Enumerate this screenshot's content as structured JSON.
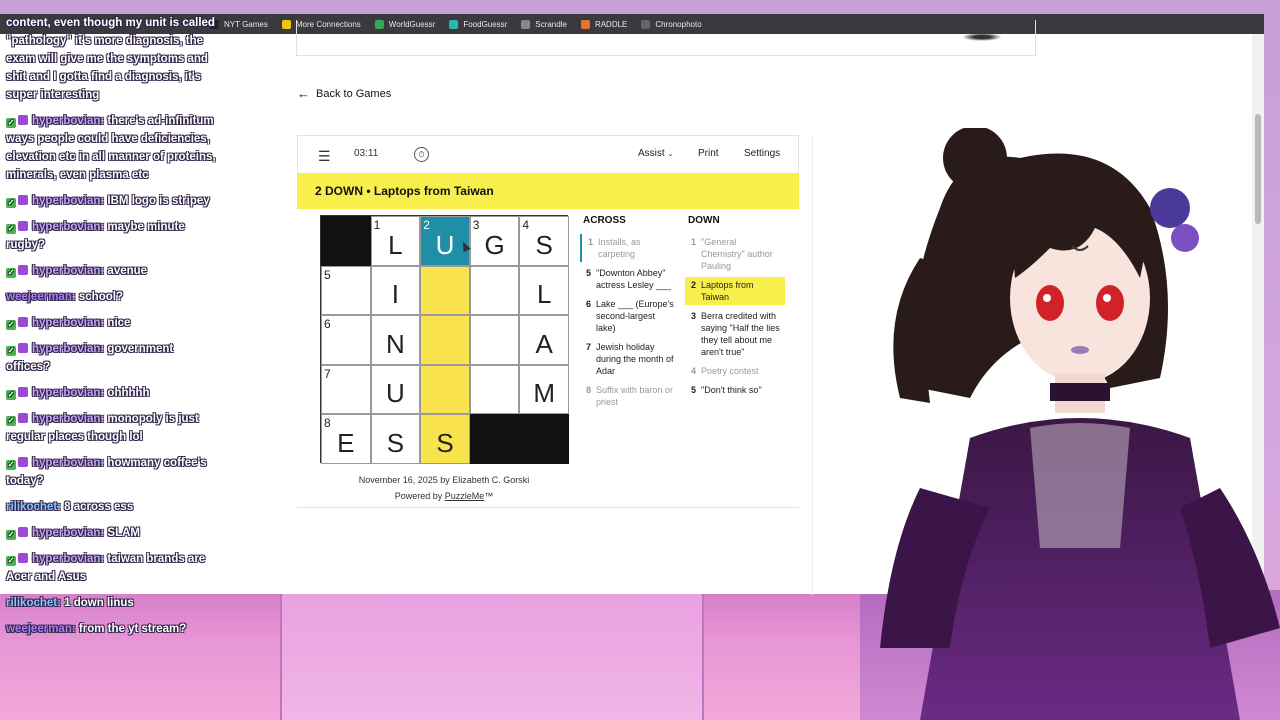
{
  "bookmarks": [
    {
      "label": "NYT Games",
      "color": "#222222"
    },
    {
      "label": "More Connections",
      "color": "#f4c20d"
    },
    {
      "label": "WorldGuessr",
      "color": "#34a853"
    },
    {
      "label": "FoodGuessr",
      "color": "#2bb5a8"
    },
    {
      "label": "Scrandle",
      "color": "#888888"
    },
    {
      "label": "RADDLE",
      "color": "#e8742a"
    },
    {
      "label": "Chronophoto",
      "color": "#666666"
    }
  ],
  "nav": {
    "back_label": "Back to Games"
  },
  "toolbar": {
    "timer": "03:11",
    "assist_label": "Assist",
    "print_label": "Print",
    "settings_label": "Settings"
  },
  "banner": {
    "clue": "2 DOWN  •  Laptops from Taiwan"
  },
  "grid": [
    [
      {
        "black": true
      },
      {
        "num": "1",
        "letter": "L"
      },
      {
        "num": "2",
        "letter": "U",
        "state": "sel"
      },
      {
        "num": "3",
        "letter": "G"
      },
      {
        "num": "4",
        "letter": "S"
      }
    ],
    [
      {
        "num": "5",
        "letter": ""
      },
      {
        "letter": "I"
      },
      {
        "letter": "",
        "state": "hl"
      },
      {
        "letter": ""
      },
      {
        "letter": "L"
      }
    ],
    [
      {
        "num": "6",
        "letter": ""
      },
      {
        "letter": "N"
      },
      {
        "letter": "",
        "state": "hl"
      },
      {
        "letter": ""
      },
      {
        "letter": "A"
      }
    ],
    [
      {
        "num": "7",
        "letter": ""
      },
      {
        "letter": "U"
      },
      {
        "letter": "",
        "state": "hl"
      },
      {
        "letter": ""
      },
      {
        "letter": "M"
      }
    ],
    [
      {
        "num": "8",
        "letter": "E"
      },
      {
        "letter": "S"
      },
      {
        "letter": "S",
        "state": "hl"
      },
      {
        "black": true
      },
      {
        "black": true
      }
    ]
  ],
  "clues": {
    "across_title": "ACROSS",
    "down_title": "DOWN",
    "across": [
      {
        "num": "1",
        "text": "Installs, as carpeting",
        "state": "dim"
      },
      {
        "num": "5",
        "text": "\"Downton Abbey\" actress Lesley ___",
        "state": ""
      },
      {
        "num": "6",
        "text": "Lake ___ (Europe's second-largest lake)",
        "state": ""
      },
      {
        "num": "7",
        "text": "Jewish holiday during the month of Adar",
        "state": ""
      },
      {
        "num": "8",
        "text": "Suffix with baron or priest",
        "state": "dim"
      }
    ],
    "down": [
      {
        "num": "1",
        "text": "\"General Chemistry\" author Pauling",
        "state": "dim"
      },
      {
        "num": "2",
        "text": "Laptops from Taiwan",
        "state": "active"
      },
      {
        "num": "3",
        "text": "Berra credited with saying \"Half the lies they tell about me aren't true\"",
        "state": ""
      },
      {
        "num": "4",
        "text": "Poetry contest",
        "state": "dim"
      },
      {
        "num": "5",
        "text": "\"Don't think so\"",
        "state": ""
      }
    ]
  },
  "byline": {
    "line1": "November 16, 2025 by Elizabeth C. Gorski",
    "powered_prefix": "Powered by ",
    "powered_link": "PuzzleMe",
    "powered_suffix": "™"
  },
  "chat": [
    {
      "user": "",
      "text": "content, even though my unit is called \"pathology\" it's more diagnosis, the exam will give me the symptoms and shit and I gotta find a diagnosis, it's super interesting",
      "badges": false
    },
    {
      "user": "hyperbovian:",
      "text": "there's ad-infinitum ways people could have deficiencies, elevation etc in all manner of proteins, minerals, even plasma etc",
      "badges": true
    },
    {
      "user": "hyperbovian:",
      "text": "IBM logo is stripey",
      "badges": true
    },
    {
      "user": "hyperbovian:",
      "text": "maybe minute rugby?",
      "badges": true
    },
    {
      "user": "hyperbovian:",
      "text": "avenue",
      "badges": true
    },
    {
      "user": "weejeerman:",
      "text": "school?",
      "badges": false,
      "cls": "c"
    },
    {
      "user": "hyperbovian:",
      "text": "nice",
      "badges": true
    },
    {
      "user": "hyperbovian:",
      "text": "government offices?",
      "badges": true
    },
    {
      "user": "hyperbovian:",
      "text": "ohhhhh",
      "badges": true
    },
    {
      "user": "hyperbovian:",
      "text": "monopoly is just regular places though lol",
      "badges": true
    },
    {
      "user": "hyperbovian:",
      "text": "howmany coffee's today?",
      "badges": true
    },
    {
      "user": "rilikochet:",
      "text": "8 across ess",
      "badges": false,
      "cls": "b"
    },
    {
      "user": "hyperbovian:",
      "text": "SLAM",
      "badges": true
    },
    {
      "user": "hyperbovian:",
      "text": "taiwan brands are Acer and Asus",
      "badges": true
    },
    {
      "user": "rilikochet:",
      "text": "1 down linus",
      "badges": false,
      "cls": "b"
    },
    {
      "user": "weejeerman:",
      "text": "from the yt stream?",
      "badges": false,
      "cls": "c"
    }
  ]
}
